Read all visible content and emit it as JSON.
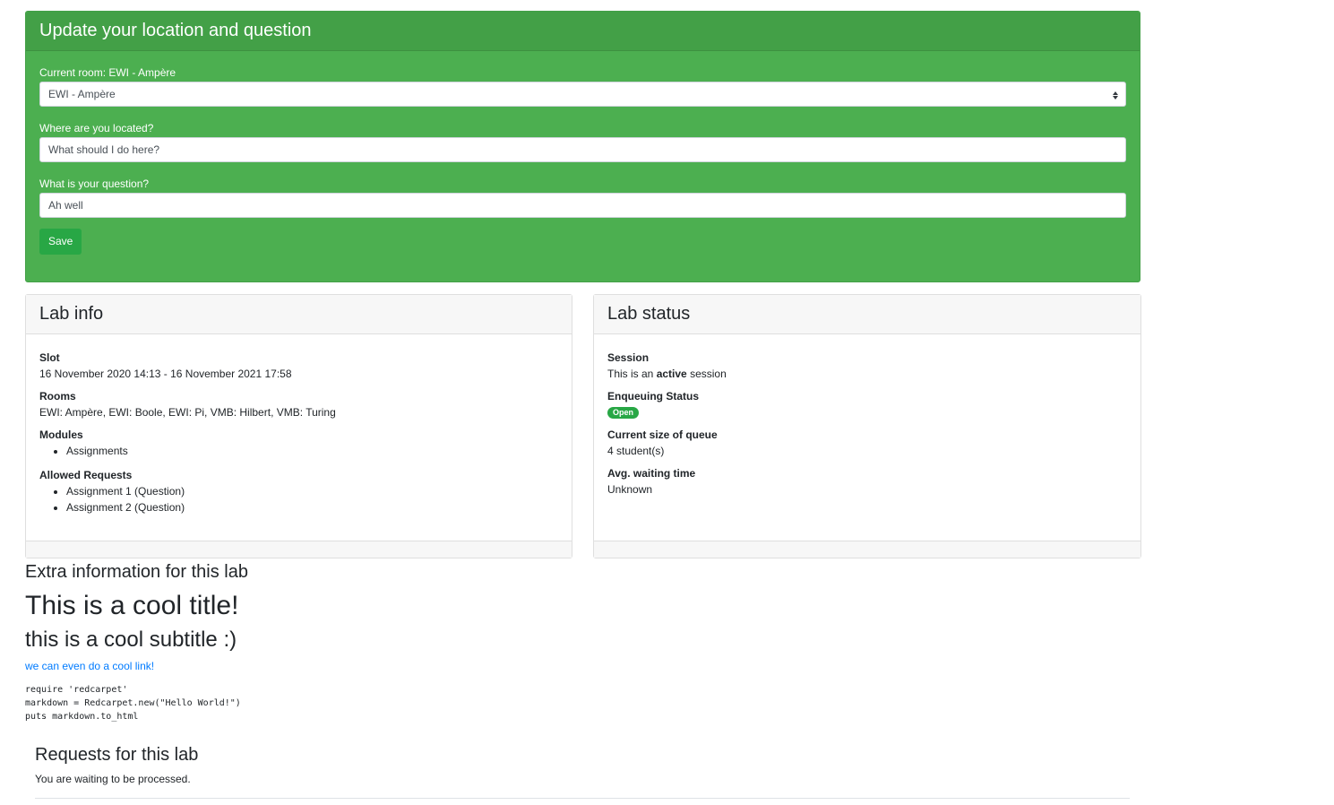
{
  "update_form": {
    "title": "Update your location and question",
    "current_room_label": "Current room: EWI - Ampère",
    "room_select_value": "EWI - Ampère",
    "location_label": "Where are you located?",
    "location_value": "What should I do here?",
    "question_label": "What is your question?",
    "question_value": "Ah well",
    "save_label": "Save"
  },
  "lab_info": {
    "title": "Lab info",
    "slot_label": "Slot",
    "slot_value": "16 November 2020 14:13 - 16 November 2021 17:58",
    "rooms_label": "Rooms",
    "rooms_value": "EWI: Ampère, EWI: Boole, EWI: Pi, VMB: Hilbert, VMB: Turing",
    "modules_label": "Modules",
    "modules": [
      "Assignments"
    ],
    "allowed_requests_label": "Allowed Requests",
    "allowed_requests": [
      "Assignment 1 (Question)",
      "Assignment 2 (Question)"
    ]
  },
  "lab_status": {
    "title": "Lab status",
    "session_label": "Session",
    "session_prefix": "This is an",
    "session_state": "active",
    "session_suffix": "session",
    "enqueuing_label": "Enqueuing Status",
    "enqueuing_badge": "Open",
    "queue_size_label": "Current size of queue",
    "queue_size_value": "4 student(s)",
    "avg_wait_label": "Avg. waiting time",
    "avg_wait_value": "Unknown",
    "colors": {
      "badge_open": "#28a745"
    }
  },
  "extra_info": {
    "heading": "Extra information for this lab",
    "title": "This is a cool title!",
    "subtitle": "this is a cool subtitle :)",
    "link_text": "we can even do a cool link!",
    "code": "require 'redcarpet'\nmarkdown = Redcarpet.new(\"Hello World!\")\nputs markdown.to_html"
  },
  "requests": {
    "heading": "Requests for this lab",
    "status_text": "You are waiting to be processed."
  },
  "colors": {
    "update_card_bg": "#4caf50",
    "update_header_bg": "#43a047",
    "save_button": "#28a745",
    "link": "#007bff"
  }
}
